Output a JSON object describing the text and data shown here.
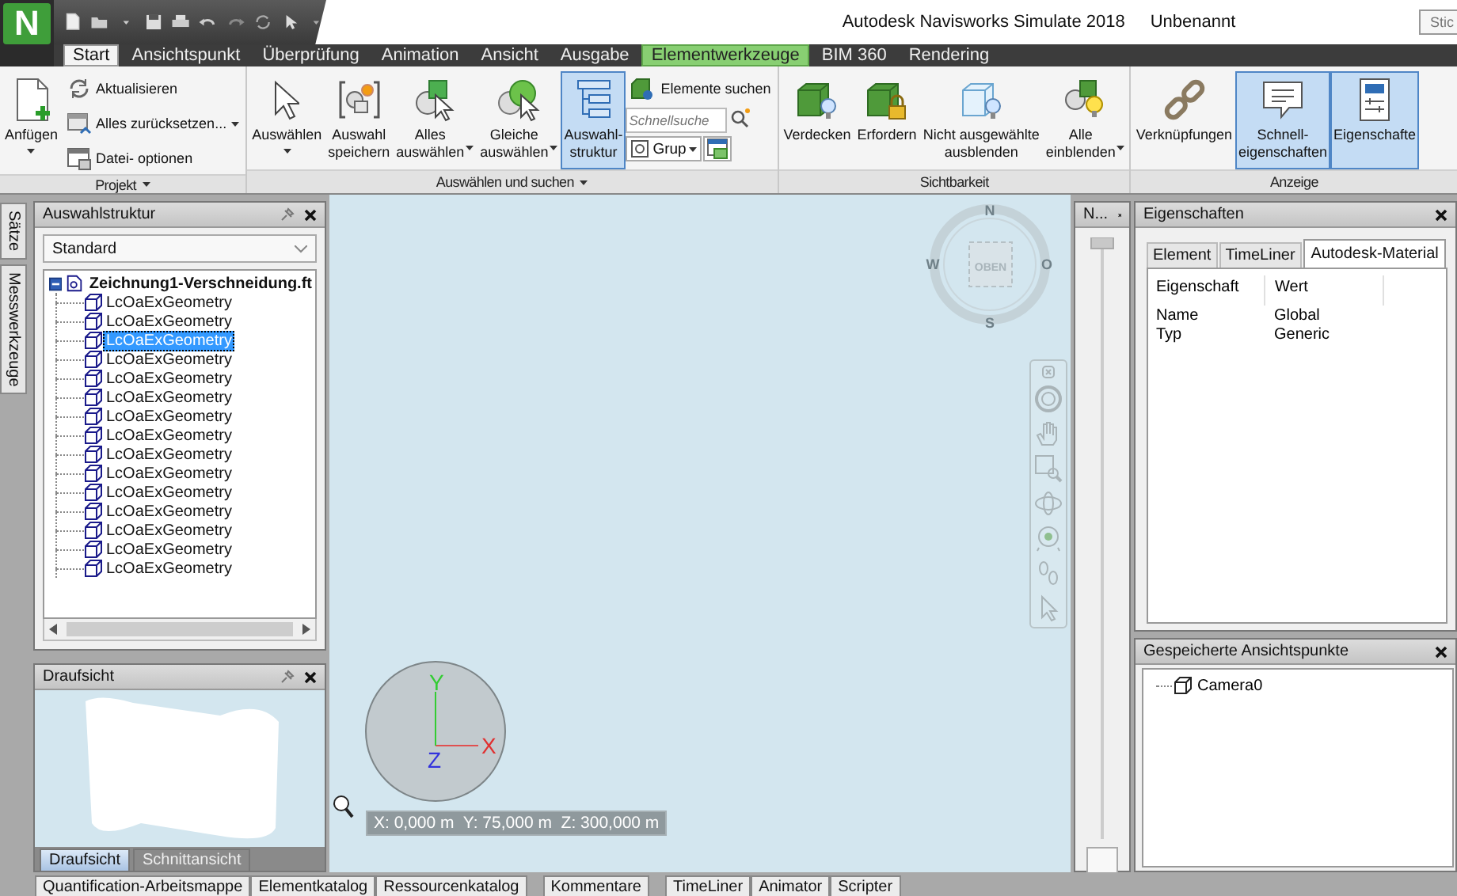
{
  "app": {
    "logo_text": "N"
  },
  "window": {
    "title": "Autodesk Navisworks Simulate 2018",
    "document": "Unbenannt"
  },
  "search": {
    "placeholder": "Stic"
  },
  "ribbon_tabs": [
    {
      "label": "Start",
      "selected": true,
      "kind": "normal"
    },
    {
      "label": "Ansichtspunkt",
      "selected": false,
      "kind": "normal"
    },
    {
      "label": "Überprüfung",
      "selected": false,
      "kind": "normal"
    },
    {
      "label": "Animation",
      "selected": false,
      "kind": "normal"
    },
    {
      "label": "Ansicht",
      "selected": false,
      "kind": "normal"
    },
    {
      "label": "Ausgabe",
      "selected": false,
      "kind": "normal"
    },
    {
      "label": "Elementwerkzeuge",
      "selected": false,
      "kind": "contextual"
    },
    {
      "label": "BIM 360",
      "selected": false,
      "kind": "normal"
    },
    {
      "label": "Rendering",
      "selected": false,
      "kind": "normal"
    }
  ],
  "ribbon_panels": [
    {
      "label": "Projekt",
      "menu": true,
      "items": [
        {
          "kind": "large",
          "label": "Anfügen",
          "dropdown": true,
          "selected": false
        },
        {
          "kind": "stack",
          "items": [
            {
              "kind": "small",
              "label": "Aktualisieren",
              "dropdown": false
            },
            {
              "kind": "small",
              "label": "Alles zurücksetzen...",
              "dropdown": true
            },
            {
              "kind": "small",
              "label": "Datei- optionen",
              "dropdown": false
            }
          ]
        }
      ]
    },
    {
      "label": "Auswählen und suchen",
      "menu": true,
      "items": [
        {
          "kind": "large",
          "label": "Auswählen",
          "dropdown": true,
          "selected": false
        },
        {
          "kind": "large",
          "label": "Auswahl\nspeichern",
          "dropdown": false,
          "selected": false
        },
        {
          "kind": "large",
          "label": "Alles\nauswählen",
          "dropdown": true,
          "selected": false
        },
        {
          "kind": "large",
          "label": "Gleiche\nauswählen",
          "dropdown": true,
          "selected": false
        },
        {
          "kind": "large",
          "label": "Auswahl-\nstruktur",
          "dropdown": false,
          "selected": true
        },
        {
          "kind": "stack",
          "items": [
            {
              "kind": "small",
              "label": "Elemente suchen",
              "dropdown": false
            },
            {
              "kind": "search",
              "placeholder": "Schnellsuche"
            },
            {
              "kind": "combo",
              "value": "Grup"
            }
          ]
        }
      ]
    },
    {
      "label": "Sichtbarkeit",
      "menu": false,
      "items": [
        {
          "kind": "large",
          "label": "Verdecken",
          "dropdown": false,
          "selected": false
        },
        {
          "kind": "large",
          "label": "Erfordern",
          "dropdown": false,
          "selected": false
        },
        {
          "kind": "large",
          "label": "Nicht ausgewählte\nausblenden",
          "dropdown": false,
          "selected": false
        },
        {
          "kind": "large",
          "label": "Alle\neinblenden",
          "dropdown": true,
          "selected": false
        }
      ]
    },
    {
      "label": "Anzeige",
      "menu": false,
      "items": [
        {
          "kind": "large",
          "label": "Verknüpfungen",
          "dropdown": false,
          "selected": false
        },
        {
          "kind": "large",
          "label": "Schnell-\neigenschaften",
          "dropdown": false,
          "selected": true
        },
        {
          "kind": "large",
          "label": "Eigenschafte",
          "dropdown": false,
          "selected": true
        }
      ]
    }
  ],
  "side_tabs": [
    {
      "label": "Sätze"
    },
    {
      "label": "Messwerkzeuge"
    }
  ],
  "selection_tree": {
    "title": "Auswahlstruktur",
    "filter": "Standard",
    "tree": [
      {
        "label": "Zeichnung1-Verschneidung.ft",
        "expanded": true,
        "selected": false,
        "children": [
          {
            "label": "LcOaExGeometry",
            "selected": false
          },
          {
            "label": "LcOaExGeometry",
            "selected": false
          },
          {
            "label": "LcOaExGeometry",
            "selected": true
          },
          {
            "label": "LcOaExGeometry",
            "selected": false
          },
          {
            "label": "LcOaExGeometry",
            "selected": false
          },
          {
            "label": "LcOaExGeometry",
            "selected": false
          },
          {
            "label": "LcOaExGeometry",
            "selected": false
          },
          {
            "label": "LcOaExGeometry",
            "selected": false
          },
          {
            "label": "LcOaExGeometry",
            "selected": false
          },
          {
            "label": "LcOaExGeometry",
            "selected": false
          },
          {
            "label": "LcOaExGeometry",
            "selected": false
          },
          {
            "label": "LcOaExGeometry",
            "selected": false
          },
          {
            "label": "LcOaExGeometry",
            "selected": false
          },
          {
            "label": "LcOaExGeometry",
            "selected": false
          },
          {
            "label": "LcOaExGeometry",
            "selected": false
          }
        ]
      }
    ]
  },
  "plan_view": {
    "title": "Draufsicht",
    "tabs": [
      {
        "label": "Draufsicht",
        "selected": true
      },
      {
        "label": "Schnittansicht",
        "selected": false
      }
    ]
  },
  "viewport": {
    "viewcube": {
      "face": "OBEN",
      "north": "N",
      "west": "W",
      "east": "O",
      "south": "S"
    },
    "axes": {
      "x": "X",
      "y": "Y",
      "z": "Z"
    },
    "coordinates": "X: 0,000 m  Y: 75,000 m  Z: 300,000 m"
  },
  "tilt_panel": {
    "title": "N..."
  },
  "properties": {
    "title": "Eigenschaften",
    "tabs": [
      {
        "label": "Element",
        "selected": false
      },
      {
        "label": "TimeLiner",
        "selected": false
      },
      {
        "label": "Autodesk-Material",
        "selected": true
      }
    ],
    "columns": [
      "Eigenschaft",
      "Wert"
    ],
    "rows": [
      [
        "Name",
        "Global"
      ],
      [
        "Typ",
        "Generic"
      ]
    ]
  },
  "saved_viewpoints": {
    "title": "Gespeicherte Ansichtspunkte",
    "items": [
      {
        "label": "Camera0"
      }
    ]
  },
  "bottom_tabs": [
    {
      "tabs": [
        {
          "label": "Quantification-Arbeitsmappe"
        },
        {
          "label": "Elementkatalog"
        },
        {
          "label": "Ressourcenkatalog"
        }
      ]
    },
    {
      "tabs": [
        {
          "label": "Kommentare"
        }
      ]
    },
    {
      "tabs": [
        {
          "label": "TimeLiner"
        },
        {
          "label": "Animator"
        },
        {
          "label": "Scripter"
        }
      ]
    }
  ]
}
